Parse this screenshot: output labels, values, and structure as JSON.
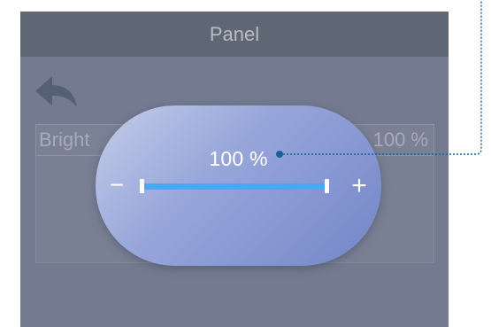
{
  "header": {
    "title": "Panel"
  },
  "icons": {
    "back": "back-arrow-icon",
    "minus": "minus-icon",
    "plus": "plus-icon"
  },
  "row": {
    "label": "Bright",
    "value": "100 %"
  },
  "popup": {
    "value_text": "100 %",
    "minus_symbol": "−",
    "plus_symbol": "+",
    "slider_level": 1.0
  },
  "colors": {
    "accent": "#4aa7f3",
    "callout": "#1c5e9a"
  }
}
